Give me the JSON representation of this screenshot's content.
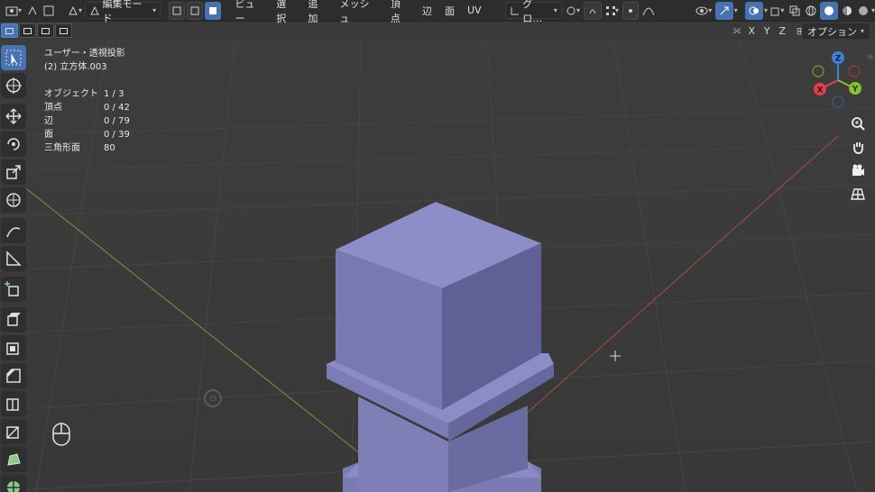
{
  "header": {
    "mode_label": "編集モード",
    "menus": [
      "ビュー",
      "選択",
      "追加",
      "メッシュ",
      "頂点",
      "辺",
      "面",
      "UV"
    ],
    "transform_orientation": "グロ…"
  },
  "row2": {
    "axes": [
      "X",
      "Y",
      "Z"
    ],
    "options_label": "オプション"
  },
  "overlay": {
    "view_name": "ユーザー・透視投影",
    "object_name": "(2) 立方体.003",
    "stats": [
      {
        "label": "オブジェクト",
        "value": "1 / 3"
      },
      {
        "label": "頂点",
        "value": "0 / 42"
      },
      {
        "label": "辺",
        "value": "0 / 79"
      },
      {
        "label": "面",
        "value": "0 / 39"
      },
      {
        "label": "三角形面",
        "value": "80"
      }
    ]
  },
  "gizmo": {
    "x": "X",
    "y": "Y",
    "z": "Z"
  },
  "colors": {
    "accent": "#4772b3",
    "mesh": "#7f80b6",
    "axis_x": "#e0414f",
    "axis_y": "#8bbf2f",
    "axis_z": "#3d82d9"
  }
}
